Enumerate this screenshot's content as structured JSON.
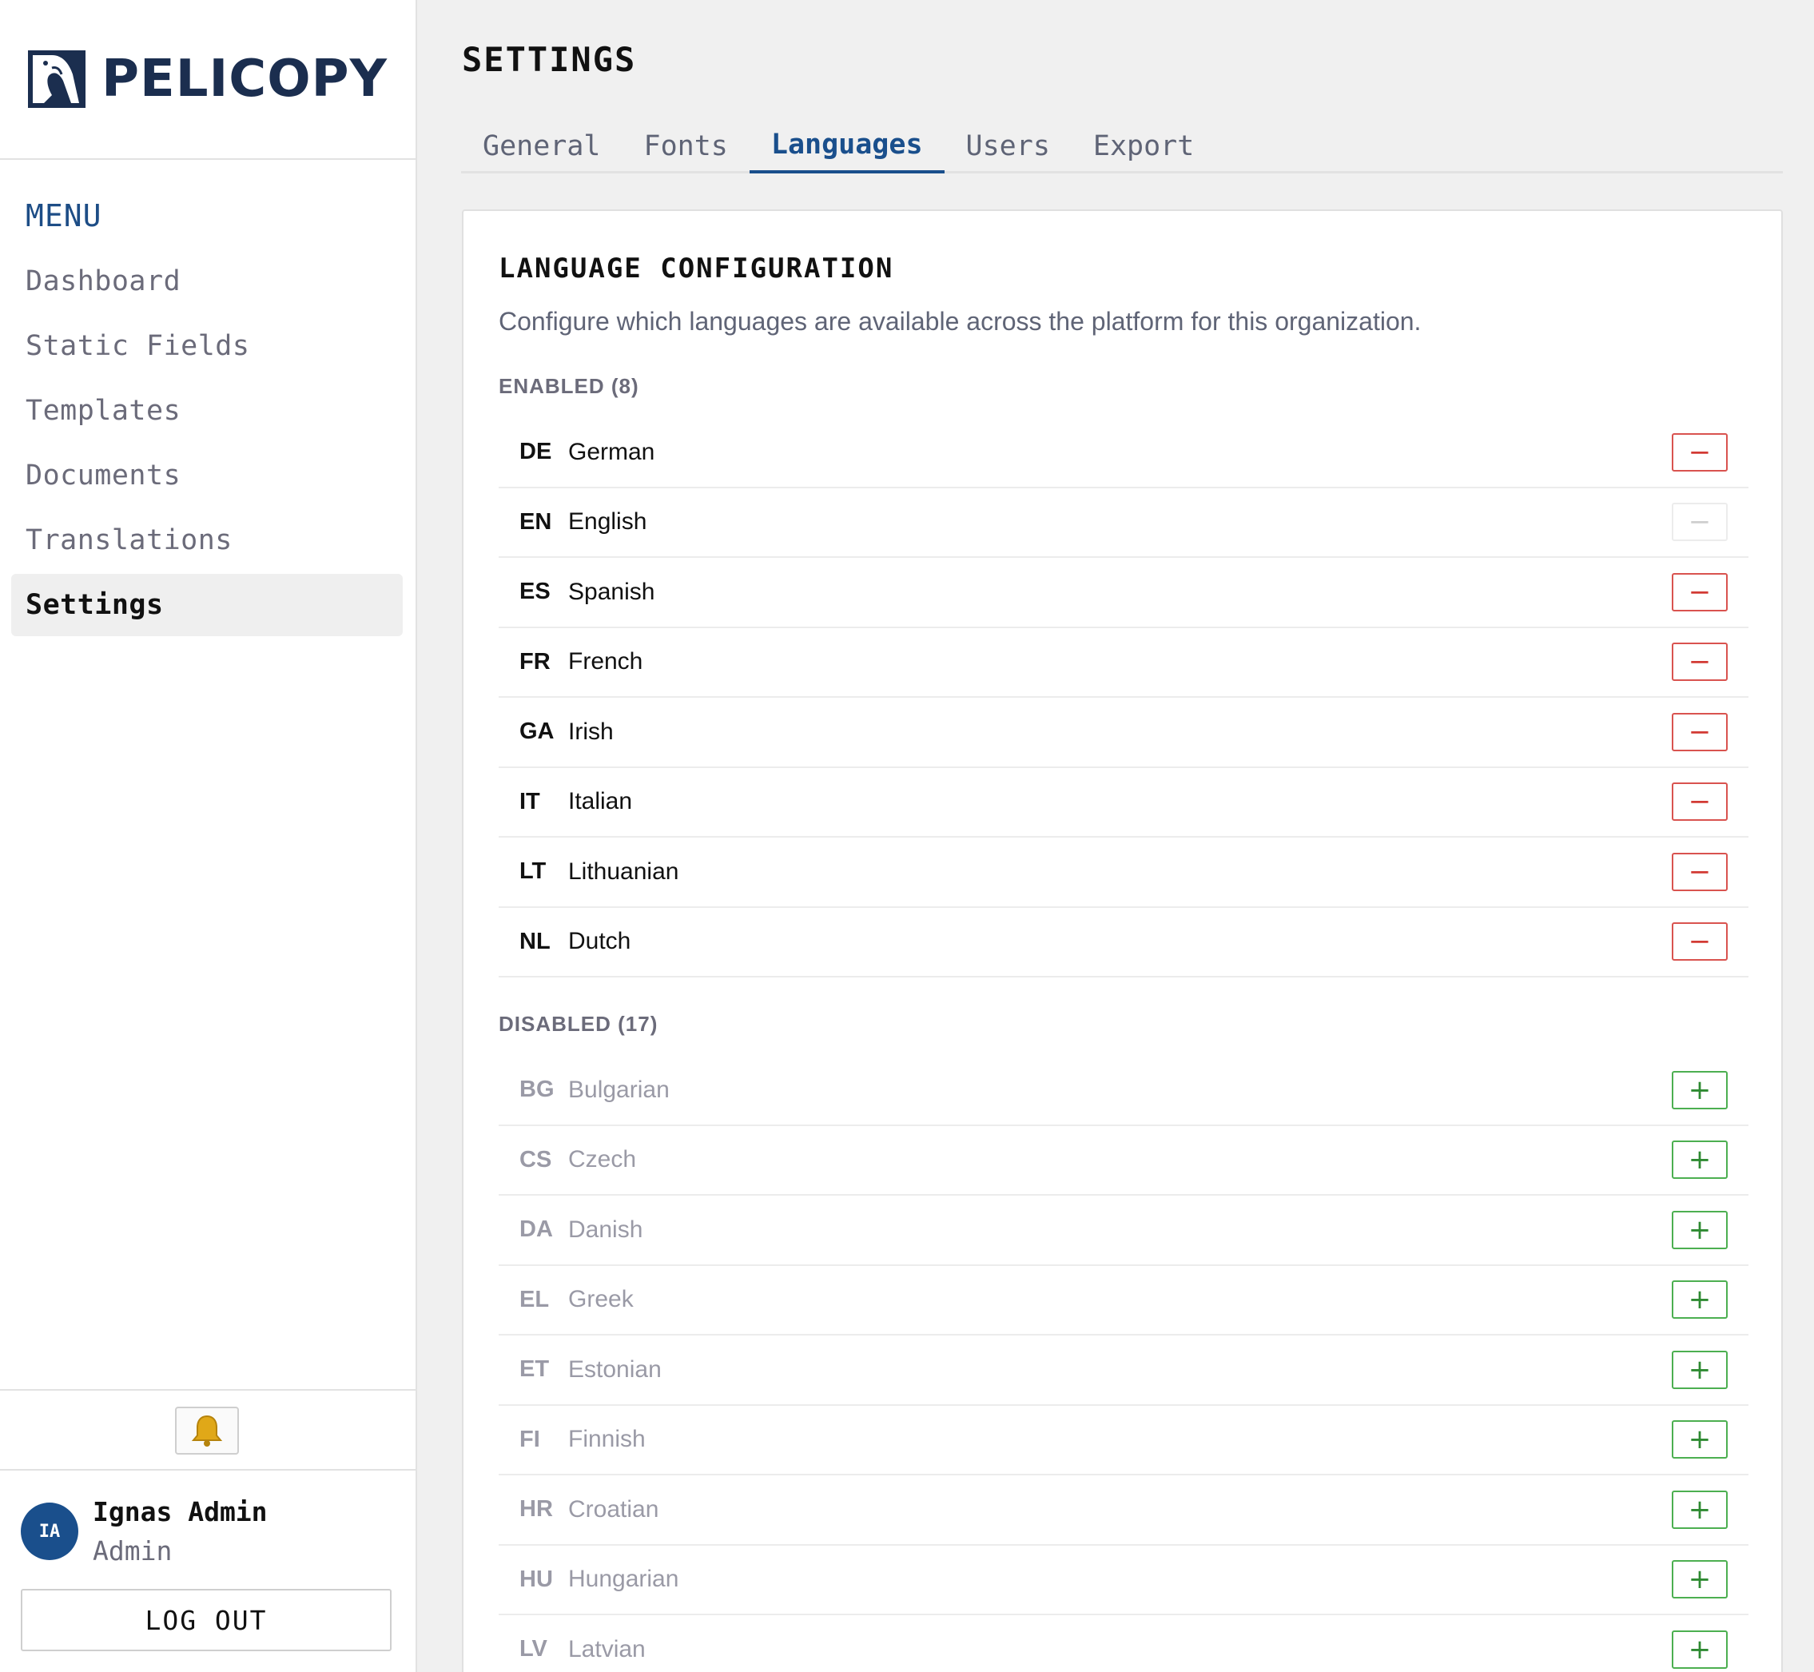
{
  "brand": {
    "name": "PELICOPY",
    "logo_icon": "pelican-logo-icon"
  },
  "sidebar": {
    "menu_title": "MENU",
    "items": [
      {
        "label": "Dashboard",
        "active": false
      },
      {
        "label": "Static Fields",
        "active": false
      },
      {
        "label": "Templates",
        "active": false
      },
      {
        "label": "Documents",
        "active": false
      },
      {
        "label": "Translations",
        "active": false
      },
      {
        "label": "Settings",
        "active": true
      }
    ],
    "notifications_icon": "bell-icon",
    "user": {
      "initials": "IA",
      "name": "Ignas Admin",
      "role": "Admin"
    },
    "logout_label": "LOG OUT"
  },
  "page": {
    "title": "SETTINGS",
    "tabs": [
      {
        "label": "General",
        "active": false
      },
      {
        "label": "Fonts",
        "active": false
      },
      {
        "label": "Languages",
        "active": true
      },
      {
        "label": "Users",
        "active": false
      },
      {
        "label": "Export",
        "active": false
      }
    ]
  },
  "languages": {
    "title": "LANGUAGE CONFIGURATION",
    "description": "Configure which languages are available across the platform for this organization.",
    "enabled_label": "ENABLED (8)",
    "enabled": [
      {
        "code": "DE",
        "name": "German",
        "removable": true
      },
      {
        "code": "EN",
        "name": "English",
        "removable": false
      },
      {
        "code": "ES",
        "name": "Spanish",
        "removable": true
      },
      {
        "code": "FR",
        "name": "French",
        "removable": true
      },
      {
        "code": "GA",
        "name": "Irish",
        "removable": true
      },
      {
        "code": "IT",
        "name": "Italian",
        "removable": true
      },
      {
        "code": "LT",
        "name": "Lithuanian",
        "removable": true
      },
      {
        "code": "NL",
        "name": "Dutch",
        "removable": true
      }
    ],
    "disabled_label": "DISABLED (17)",
    "disabled": [
      {
        "code": "BG",
        "name": "Bulgarian"
      },
      {
        "code": "CS",
        "name": "Czech"
      },
      {
        "code": "DA",
        "name": "Danish"
      },
      {
        "code": "EL",
        "name": "Greek"
      },
      {
        "code": "ET",
        "name": "Estonian"
      },
      {
        "code": "FI",
        "name": "Finnish"
      },
      {
        "code": "HR",
        "name": "Croatian"
      },
      {
        "code": "HU",
        "name": "Hungarian"
      },
      {
        "code": "LV",
        "name": "Latvian"
      }
    ],
    "remove_symbol": "−",
    "add_symbol": "+"
  },
  "colors": {
    "brand": "#1b2e4f",
    "accent": "#1a4f8c",
    "remove": "#d23a34",
    "add": "#2e8a32"
  }
}
